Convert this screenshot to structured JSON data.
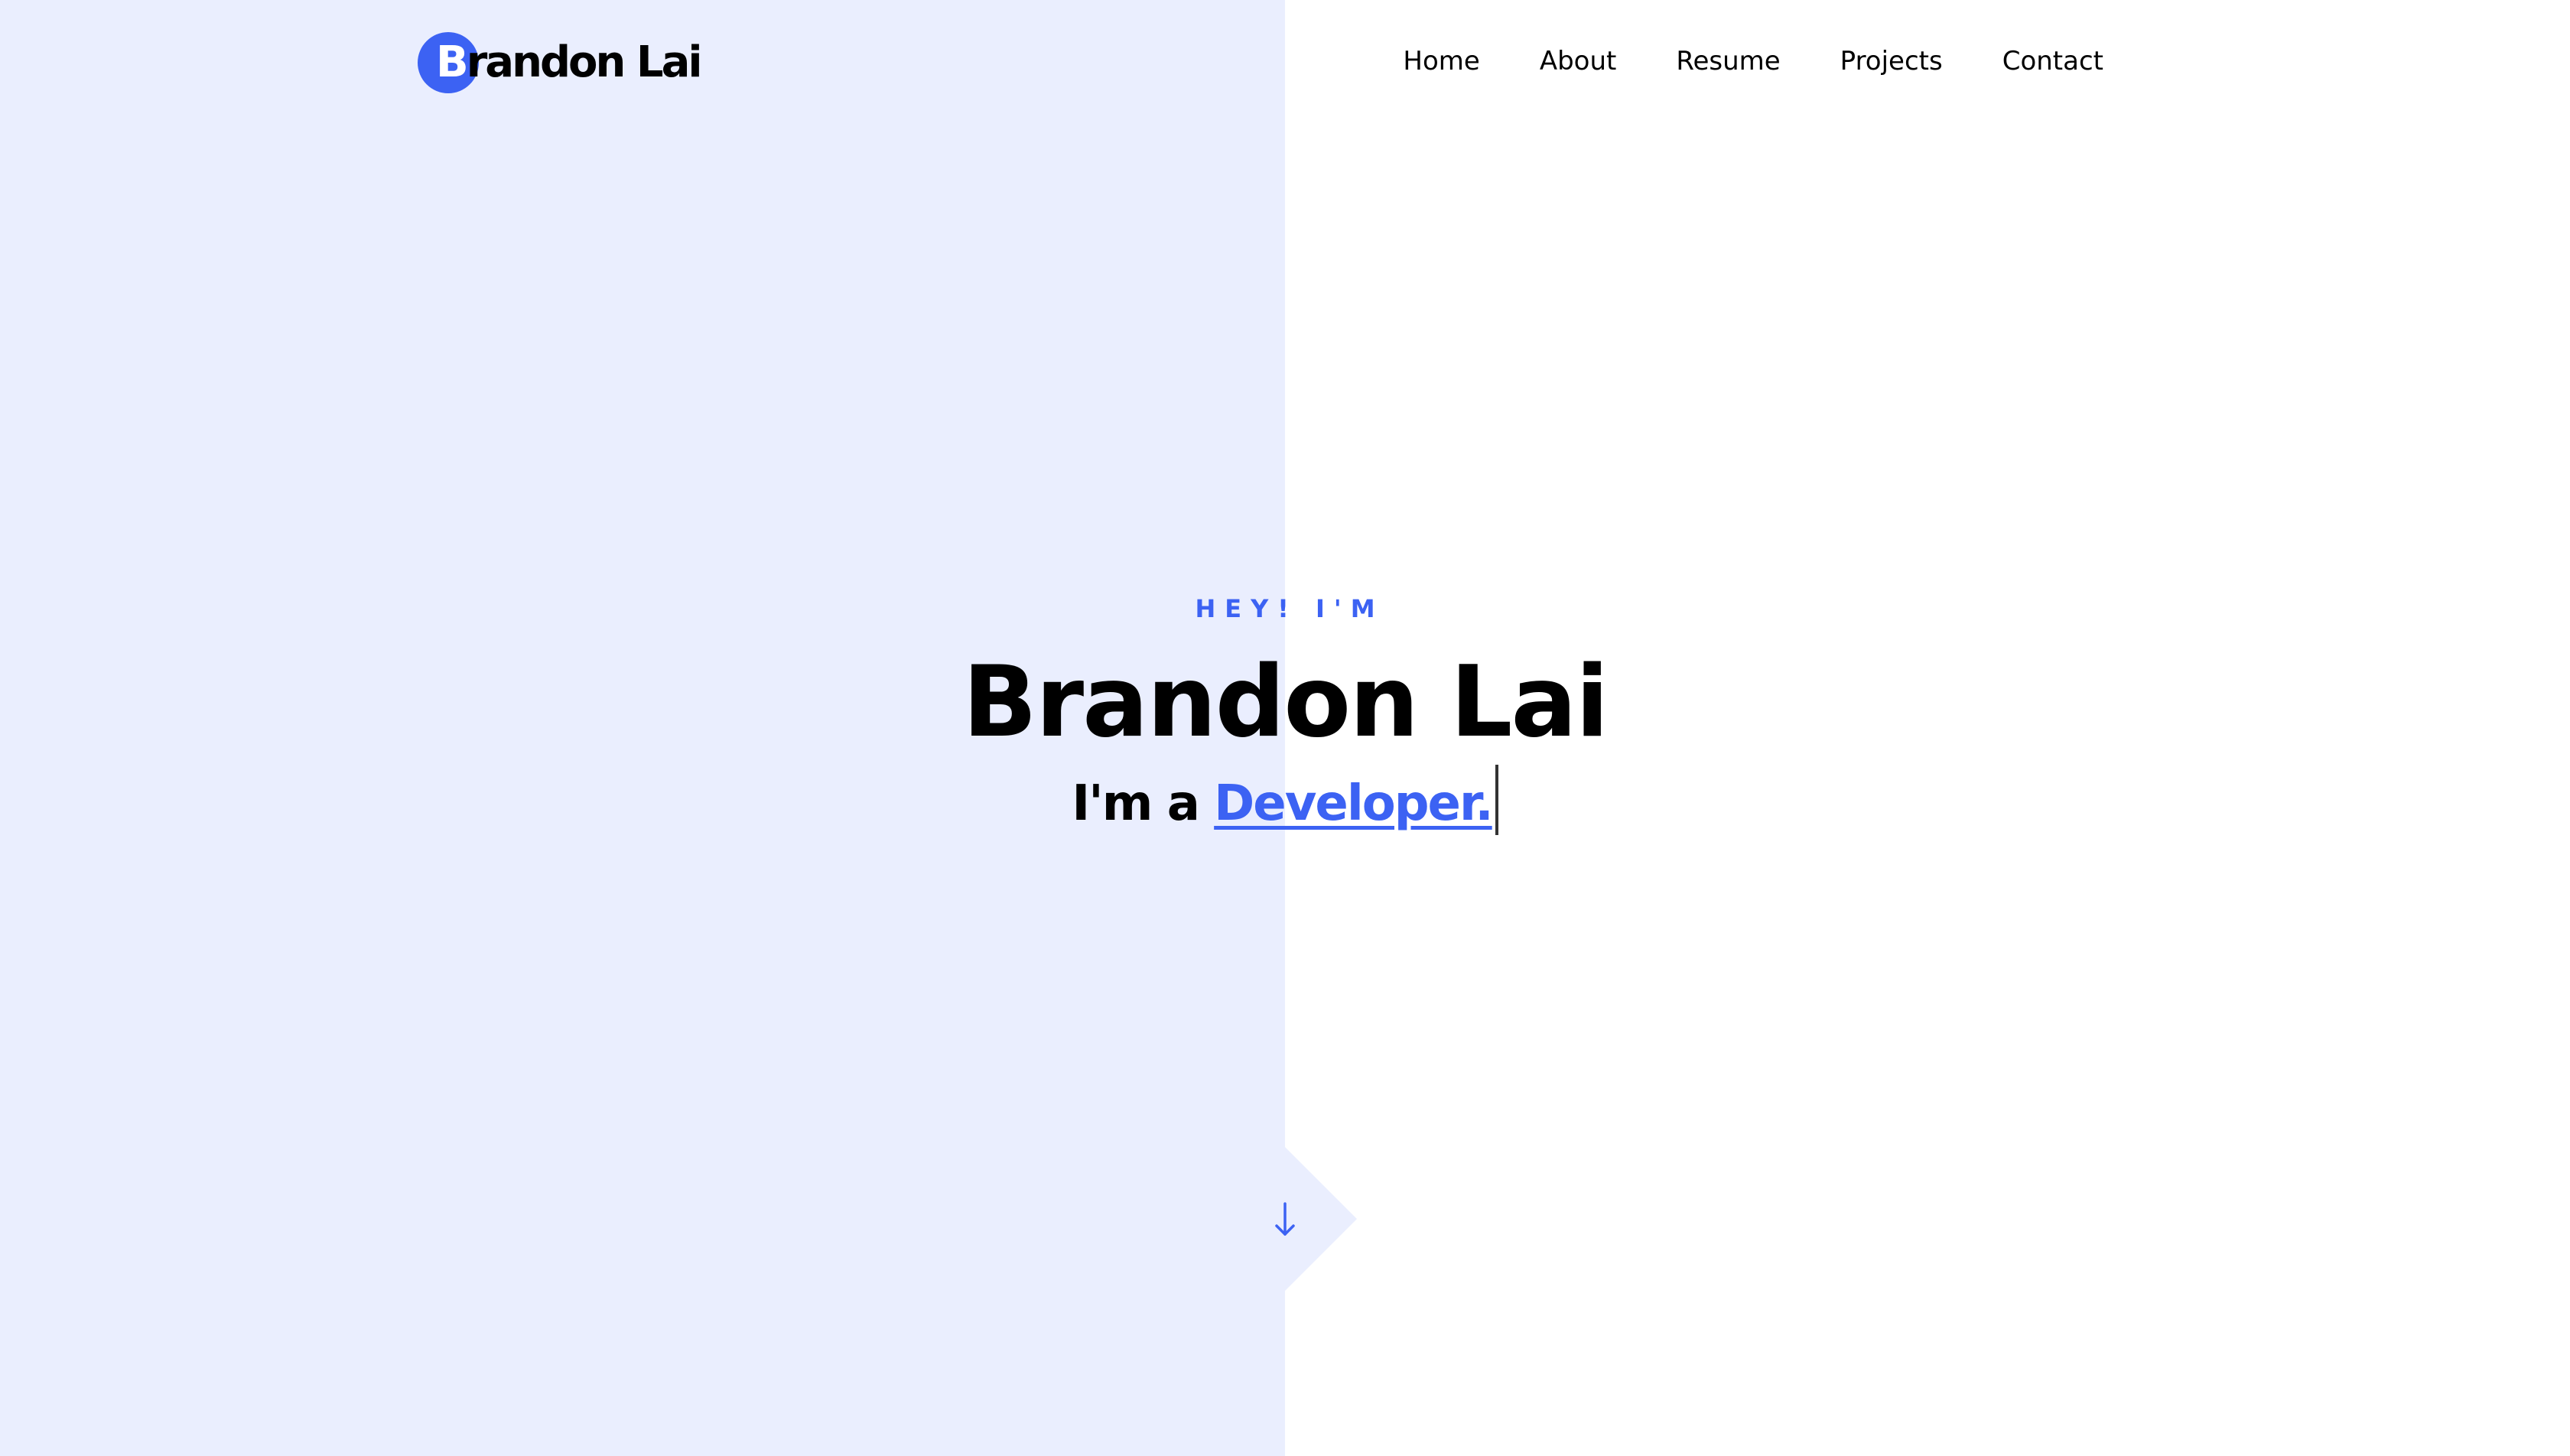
{
  "header": {
    "logo": {
      "first_letter": "B",
      "rest": "randon Lai"
    },
    "nav": [
      "Home",
      "About",
      "Resume",
      "Projects",
      "Contact"
    ]
  },
  "hero": {
    "eyebrow": "HEY! I'M",
    "name": "Brandon Lai",
    "tagline_prefix": "I'm a",
    "tagline_role": "Developer."
  },
  "colors": {
    "accent": "#3c62f3",
    "left_panel": "#eaeefe",
    "text": "#000000"
  },
  "icons": {
    "scroll_down": "arrow-down-icon"
  }
}
